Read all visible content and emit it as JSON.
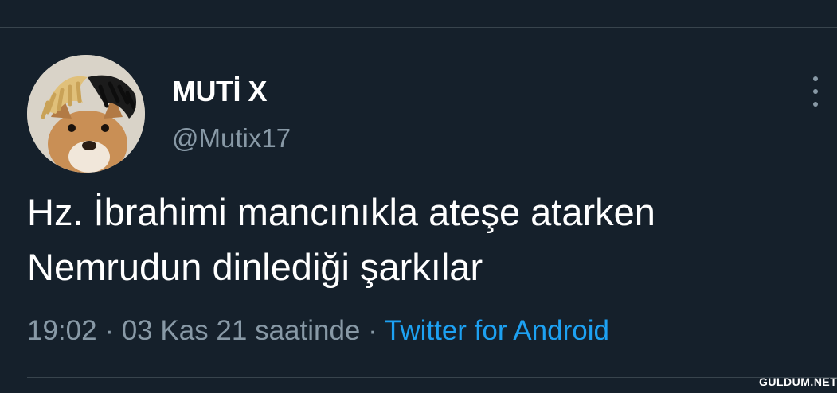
{
  "tweet": {
    "author_name": "MUTİ X",
    "author_handle": "@Mutix17",
    "text_line1": "Hz. İbrahimi mancınıkla ateşe atarken",
    "text_line2": "Nemrudun dinlediği şarkılar",
    "time": "19:02",
    "separator": "·",
    "date_text": "03 Kas 21 saatinde",
    "source": "Twitter for Android"
  },
  "watermark": "GULDUM.NET",
  "icons": {
    "more": "more-vertical-icon"
  },
  "colors": {
    "background": "#15202b",
    "secondary_text": "#8899a6",
    "link": "#1da1f2",
    "divider": "#38444d"
  }
}
